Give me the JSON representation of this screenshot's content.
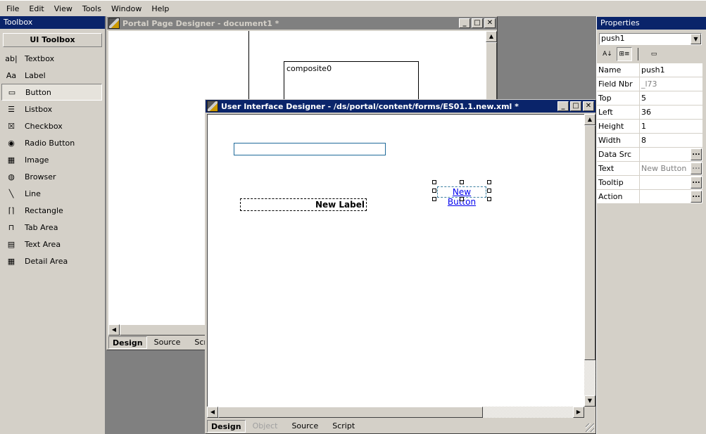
{
  "menu": [
    "File",
    "Edit",
    "View",
    "Tools",
    "Window",
    "Help"
  ],
  "toolbox": {
    "title": "Toolbox",
    "header": "UI Toolbox",
    "items": [
      {
        "label": "Textbox",
        "icon": "textbox-icon",
        "glyph": "ab|"
      },
      {
        "label": "Label",
        "icon": "label-icon",
        "glyph": "Aa"
      },
      {
        "label": "Button",
        "icon": "button-icon",
        "glyph": "▭",
        "selected": true
      },
      {
        "label": "Listbox",
        "icon": "listbox-icon",
        "glyph": "☰"
      },
      {
        "label": "Checkbox",
        "icon": "checkbox-icon",
        "glyph": "☒"
      },
      {
        "label": "Radio Button",
        "icon": "radio-button-icon",
        "glyph": "◉"
      },
      {
        "label": "Image",
        "icon": "image-icon",
        "glyph": "▦"
      },
      {
        "label": "Browser",
        "icon": "browser-icon",
        "glyph": "◍"
      },
      {
        "label": "Line",
        "icon": "line-icon",
        "glyph": "╲"
      },
      {
        "label": "Rectangle",
        "icon": "rectangle-icon",
        "glyph": "⌈⌉"
      },
      {
        "label": "Tab Area",
        "icon": "tab-area-icon",
        "glyph": "⊓"
      },
      {
        "label": "Text Area",
        "icon": "text-area-icon",
        "glyph": "▤"
      },
      {
        "label": "Detail Area",
        "icon": "detail-area-icon",
        "glyph": "▦"
      }
    ]
  },
  "portal_window": {
    "title": "Portal Page Designer - document1 *",
    "composite_label": "composite0",
    "tabs": [
      "Design",
      "Source",
      "Script"
    ]
  },
  "ui_window": {
    "title": "User Interface Designer - /ds/portal/content/forms/ES01.1.new.xml *",
    "label_text": "New Label",
    "button_text": "New Button",
    "tabs": [
      {
        "label": "Design",
        "state": "active"
      },
      {
        "label": "Object",
        "state": "disabled"
      },
      {
        "label": "Source",
        "state": "normal"
      },
      {
        "label": "Script",
        "state": "normal"
      }
    ]
  },
  "window_buttons": {
    "minimize": "_",
    "maximize": "□",
    "close": "✕"
  },
  "properties": {
    "title": "Properties",
    "selected_object": "push1",
    "rows": [
      {
        "name": "Name",
        "value": "push1"
      },
      {
        "name": "Field Nbr",
        "value": "_l73",
        "gray": true
      },
      {
        "name": "Top",
        "value": "5"
      },
      {
        "name": "Left",
        "value": "36"
      },
      {
        "name": "Height",
        "value": "1"
      },
      {
        "name": "Width",
        "value": "8"
      },
      {
        "name": "Data Src",
        "value": "",
        "ellipsis": true
      },
      {
        "name": "Text",
        "value": "New Button",
        "gray": true,
        "ellipsis": true
      },
      {
        "name": "Tooltip",
        "value": "",
        "ellipsis": true
      },
      {
        "name": "Action",
        "value": "",
        "ellipsis": true
      }
    ],
    "ellipsis_label": "..."
  },
  "colors": {
    "active_title": "#0a246a",
    "inactive_title": "#808080",
    "face": "#d4d0c8",
    "textbox_border": "#1f6a9a",
    "link": "#0000ee"
  }
}
